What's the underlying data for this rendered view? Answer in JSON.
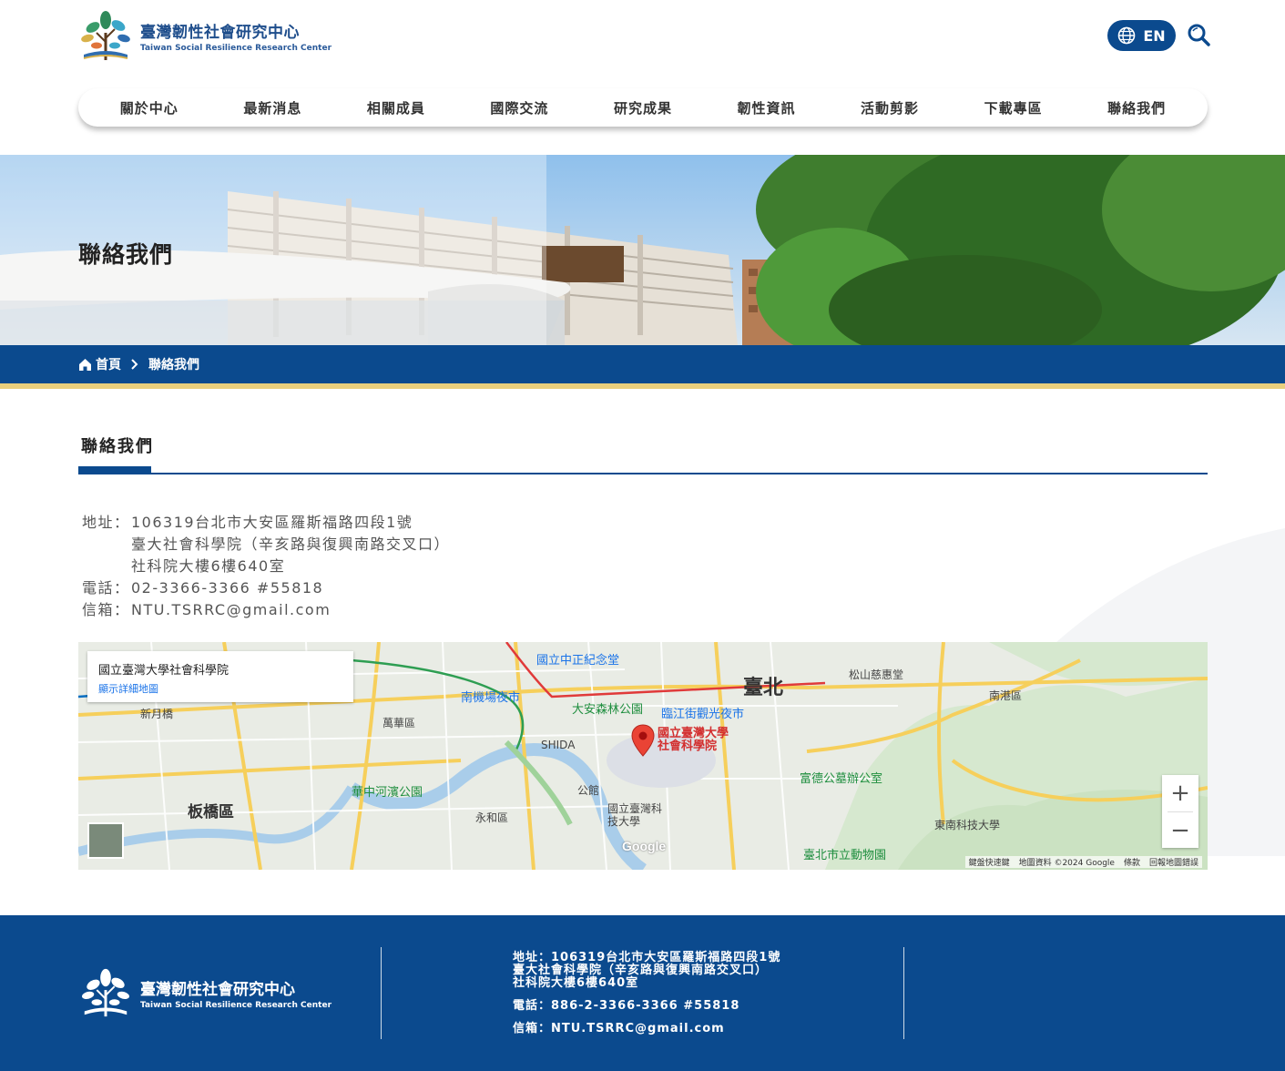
{
  "site": {
    "name": "臺灣韌性社會研究中心",
    "name_en": "Taiwan Social Resilience Research Center"
  },
  "header": {
    "lang_label": "EN"
  },
  "nav": {
    "items": [
      "關於中心",
      "最新消息",
      "相關成員",
      "國際交流",
      "研究成果",
      "韌性資訊",
      "活動剪影",
      "下載專區",
      "聯絡我們"
    ]
  },
  "banner": {
    "title": "聯絡我們"
  },
  "breadcrumb": {
    "home": "首頁",
    "current": "聯絡我們"
  },
  "section": {
    "title": "聯絡我們"
  },
  "contact": {
    "address_label": "地址：",
    "address_lines": [
      "106319台北市大安區羅斯福路四段1號",
      "臺大社會科學院（辛亥路與復興南路交叉口）",
      "社科院大樓6樓640室"
    ],
    "phone_label": "電話：",
    "phone": "02-3366-3366 #55818",
    "email_label": "信箱：",
    "email": "NTU.TSRRC@gmail.com"
  },
  "map": {
    "place_name": "國立臺灣大學社會科學院",
    "details_link": "顯示詳細地圖",
    "pin_label_1": "國立臺灣大學",
    "pin_label_2": "社會科學院",
    "zoom_in": "+",
    "zoom_out": "−",
    "logo": "Google",
    "attribution": [
      "鍵盤快速鍵",
      "地圖資料 ©2024 Google",
      "條款",
      "回報地圖錯誤"
    ],
    "labels": {
      "taipei": "臺北",
      "banqiao": "板橋區",
      "wanhua": "萬華區",
      "yonghe": "永和區",
      "nangang": "南港區",
      "songshan": "松山慈惠堂",
      "cks": "國立中正紀念堂",
      "daan_park": "大安森林公園",
      "linjiang": "臨江街觀光夜市",
      "nanjichang": "南機場夜市",
      "huazhong": "華中河濱公園",
      "ntust": "國立臺灣科技大學",
      "zoo": "臺北市立動物園",
      "shida": "SHIDA",
      "fudegong": "富德公墓辦公室",
      "donnan": "東南科技大學",
      "xinyue": "新月橋",
      "gongguan": "公館"
    }
  },
  "footer": {
    "address_line1": "地址：106319台北市大安區羅斯福路四段1號",
    "address_line2": "臺大社會科學院（辛亥路與復興南路交叉口）",
    "address_line3": "社科院大樓6樓640室",
    "phone": "電話：886-2-3366-3366 #55818",
    "email": "信箱：NTU.TSRRC@gmail.com"
  },
  "colors": {
    "brand_blue": "#0b4a8e",
    "accent_gold": "#e9cf7d"
  }
}
